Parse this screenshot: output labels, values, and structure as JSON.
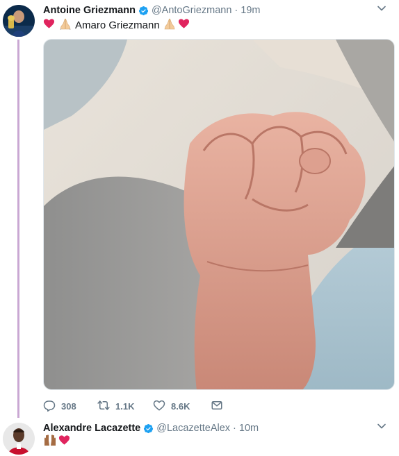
{
  "tweets": [
    {
      "name": "Antoine Griezmann",
      "handle": "@AntoGriezmann",
      "time": "19m",
      "text": "Amaro Griezmann",
      "stats": {
        "replies": "308",
        "retweets": "1.1K",
        "likes": "8.6K"
      }
    },
    {
      "name": "Alexandre Lacazette",
      "handle": "@LacazetteAlex",
      "time": "10m"
    }
  ],
  "icons": {
    "verified": "verified-badge-icon",
    "caret": "chevron-down-icon",
    "reply": "reply-icon",
    "retweet": "retweet-icon",
    "like": "heart-icon",
    "dm": "envelope-icon"
  },
  "colors": {
    "verified": "#1da1f2",
    "thread_line": "#c9a7d3",
    "secondary_text": "#657786",
    "heart_emoji": "#e0245e"
  }
}
